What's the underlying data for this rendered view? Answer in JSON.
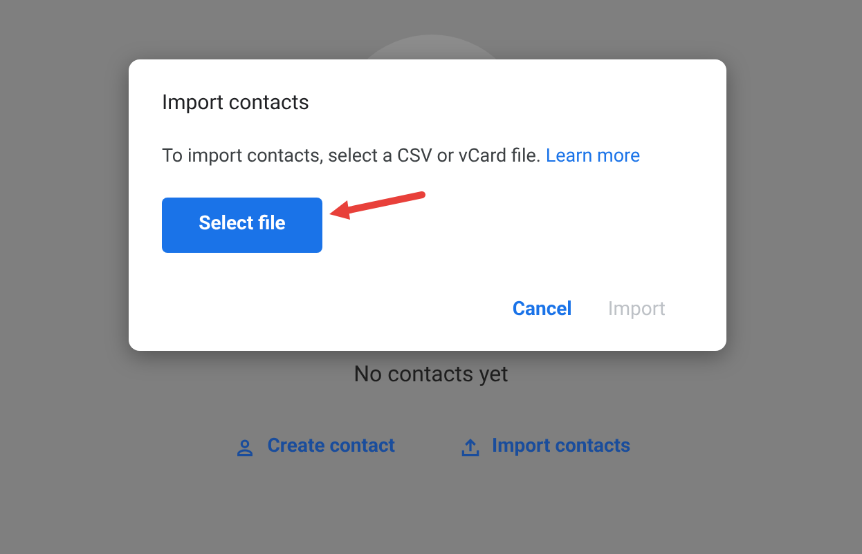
{
  "page": {
    "empty_message": "No contacts yet",
    "actions": [
      {
        "kind": "create",
        "label": "Create contact"
      },
      {
        "kind": "import",
        "label": "Import contacts"
      }
    ]
  },
  "dialog": {
    "title": "Import contacts",
    "message": "To import contacts, select a CSV or vCard file.",
    "link": "Learn more",
    "primary_button": "Select file",
    "buttons": [
      {
        "label": "Cancel",
        "disabled": false
      },
      {
        "label": "Import",
        "disabled": true
      }
    ]
  }
}
